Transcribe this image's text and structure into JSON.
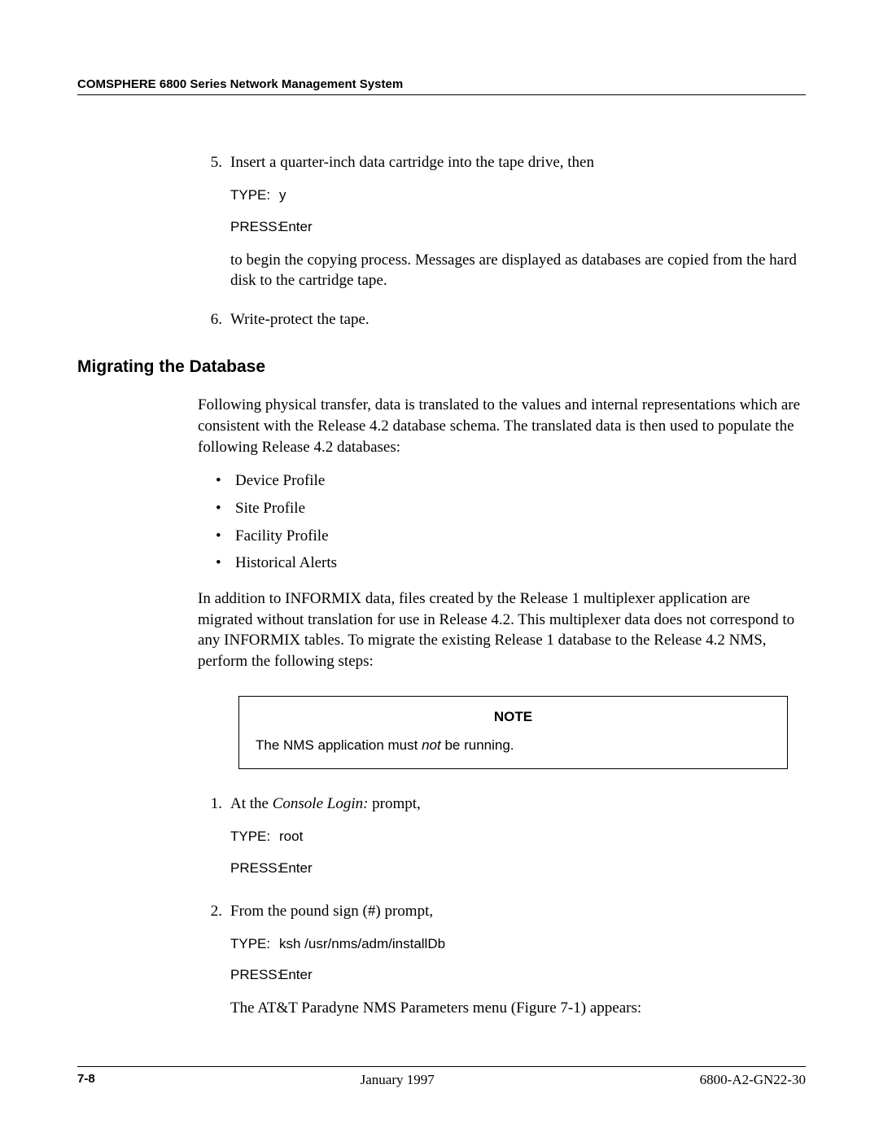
{
  "header": "COMSPHERE 6800 Series Network Management System",
  "step5": {
    "num": "5.",
    "lead": "Insert a quarter-inch data cartridge into the tape drive, then",
    "type_label": "TYPE:",
    "type_val": "y",
    "press_label": "PRESS:",
    "press_val": "Enter",
    "tail": "to begin the copying process. Messages are displayed as databases are copied from the hard disk to the cartridge tape."
  },
  "step6": {
    "num": "6.",
    "lead": "Write-protect the tape."
  },
  "section_heading": "Migrating the Database",
  "migr_intro": "Following physical transfer, data is translated to the values and internal representations which are consistent with the Release 4.2 database schema. The translated data is then used to populate the following Release 4.2 databases:",
  "migr_bullets": [
    "Device Profile",
    "Site Profile",
    "Facility Profile",
    "Historical Alerts"
  ],
  "migr_para2": "In addition to INFORMIX data, files created by the Release 1 multiplexer application are migrated without translation for use in Release 4.2. This multiplexer data does not correspond to any INFORMIX tables. To migrate the existing Release 1 database to the Release 4.2 NMS, perform the following steps:",
  "note": {
    "heading": "NOTE",
    "pre": "The NMS application must ",
    "em": "not",
    "post": " be running."
  },
  "m1": {
    "num": "1.",
    "lead_pre": "At the ",
    "lead_em": "Console Login:",
    "lead_post": " prompt,",
    "type_label": "TYPE:",
    "type_val": "root",
    "press_label": "PRESS:",
    "press_val": "Enter"
  },
  "m2": {
    "num": "2.",
    "lead": "From the pound sign (#) prompt,",
    "type_label": "TYPE:",
    "type_val": "ksh /usr/nms/adm/installDb",
    "press_label": "PRESS:",
    "press_val": "Enter",
    "tail": "The AT&T Paradyne NMS Parameters menu (Figure 7-1) appears:"
  },
  "footer": {
    "left": "7-8",
    "center": "January 1997",
    "right": "6800-A2-GN22-30"
  }
}
